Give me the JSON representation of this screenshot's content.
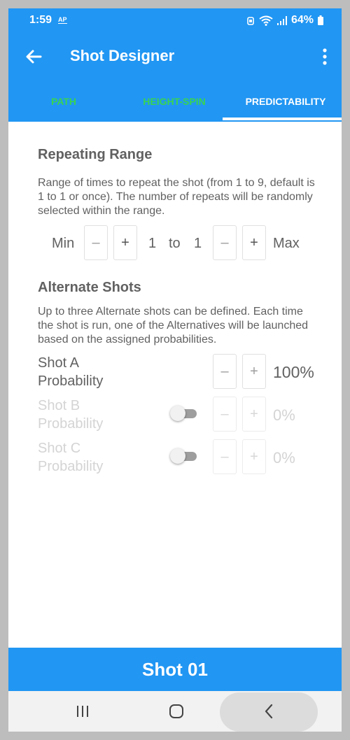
{
  "status_bar": {
    "time": "1:59",
    "ap_badge": "AP",
    "battery": "64%"
  },
  "app_bar": {
    "title": "Shot Designer"
  },
  "tabs": [
    {
      "label": "PATH"
    },
    {
      "label": "HEIGHT-SPIN"
    },
    {
      "label": "PREDICTABILITY"
    }
  ],
  "repeating_range": {
    "heading": "Repeating Range",
    "description": "Range of times to repeat the shot (from 1 to 9, default is 1 to 1 or once). The number of repeats will be randomly selected within the range.",
    "min_label": "Min",
    "max_label": "Max",
    "min_value": "1",
    "to_label": "to",
    "max_value": "1",
    "minus_symbol": "–",
    "plus_symbol": "+"
  },
  "alternate_shots": {
    "heading": "Alternate Shots",
    "description": "Up to three Alternate shots can be defined. Each time the shot is run, one of the Alternatives will be launched based on the assigned probabilities.",
    "shots": [
      {
        "name": "Shot A",
        "sub": "Probability",
        "value": "100%",
        "enabled": true
      },
      {
        "name": "Shot B",
        "sub": "Probability",
        "value": "0%",
        "enabled": false
      },
      {
        "name": "Shot C",
        "sub": "Probability",
        "value": "0%",
        "enabled": false
      }
    ]
  },
  "bottom_bar": {
    "label": "Shot 01"
  },
  "colors": {
    "primary": "#2196f3",
    "tab_inactive": "#39d353",
    "text": "#616161"
  }
}
